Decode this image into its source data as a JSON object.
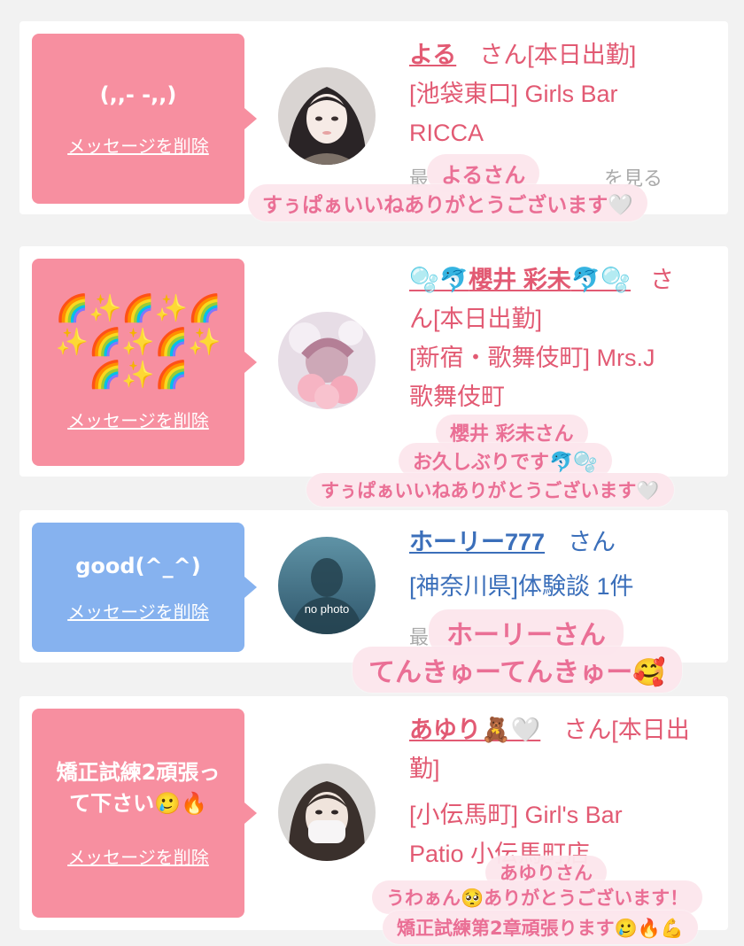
{
  "common": {
    "delete_label": "メッセージを削除",
    "san_suffix": "さん"
  },
  "cards": [
    {
      "message": "(,,- -,,)",
      "name": "よる",
      "after_name": "さん[本日出勤]",
      "shop_line1": "[池袋東口] Girls Bar",
      "shop_line2": "RICCA",
      "partial_line": "最　　　　　　　　　を見る",
      "overlay_line1": "よるさん",
      "overlay_line2": "すぅぱぁいいねありがとうございます🤍"
    },
    {
      "message": "🌈✨🌈✨🌈✨🌈✨🌈✨🌈✨🌈",
      "name_prefix": "🫧🐬",
      "name": "櫻井 彩未",
      "name_suffix": "🐬🫧",
      "after_name": "さ",
      "after_name2": "ん[本日出勤]",
      "shop_line1": "[新宿・歌舞伎町] Mrs.J",
      "shop_line2": "歌舞伎町",
      "overlay_line1": "櫻井 彩未さん",
      "overlay_line2": "お久しぶりです🐬🫧",
      "overlay_line3": "すぅぱぁいいねありがとうございます🤍"
    },
    {
      "message": "good(^_^)",
      "name": "ホーリー777",
      "after_name": "さん",
      "shop_line1": "[神奈川県]体験談 1件",
      "partial_line": "最",
      "avatar_text": "no photo",
      "overlay_line1": "ホーリーさん",
      "overlay_line2": "てんきゅーてんきゅー🥰"
    },
    {
      "message": "矯正試練2頑張って下さい🥲🔥",
      "name": "あゆり🧸🤍",
      "after_name": "さん[本日出",
      "after_name2": "勤]",
      "shop_line1": "[小伝馬町] Girl's Bar",
      "shop_line2": "Patio 小伝馬町店",
      "overlay_line1": "あゆりさん",
      "overlay_line2": "うわぁん🥺ありがとうございます！",
      "overlay_line3": "矯正試練第2章頑張ります🥲🔥💪"
    }
  ],
  "colors": {
    "pink_bubble": "#f78fa0",
    "blue_bubble": "#86b2ef",
    "name_pink": "#e25a73",
    "name_blue": "#3b6fba",
    "sticker_text": "#ea6f95"
  }
}
